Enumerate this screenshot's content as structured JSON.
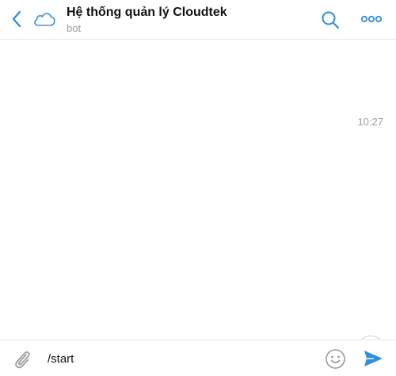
{
  "header": {
    "title": "Hệ thống quản lý Cloudtek",
    "subtitle": "bot",
    "back_icon": "chevron-left-icon",
    "avatar_icon": "cloud-icon",
    "search_icon": "search-icon",
    "more_icon": "more-dots-icon"
  },
  "messages": {
    "items": [
      {
        "time": "10:27"
      }
    ],
    "scroll_down_icon": "chevron-down-icon"
  },
  "composer": {
    "value": "/start",
    "attach_icon": "paperclip-icon",
    "emoji_icon": "smiley-icon",
    "send_icon": "send-icon"
  },
  "colors": {
    "accent": "#2d8ee0",
    "muted_text": "#9b9b9b",
    "icon_gray": "#9a9a9a",
    "divider": "#e6e6e6"
  }
}
